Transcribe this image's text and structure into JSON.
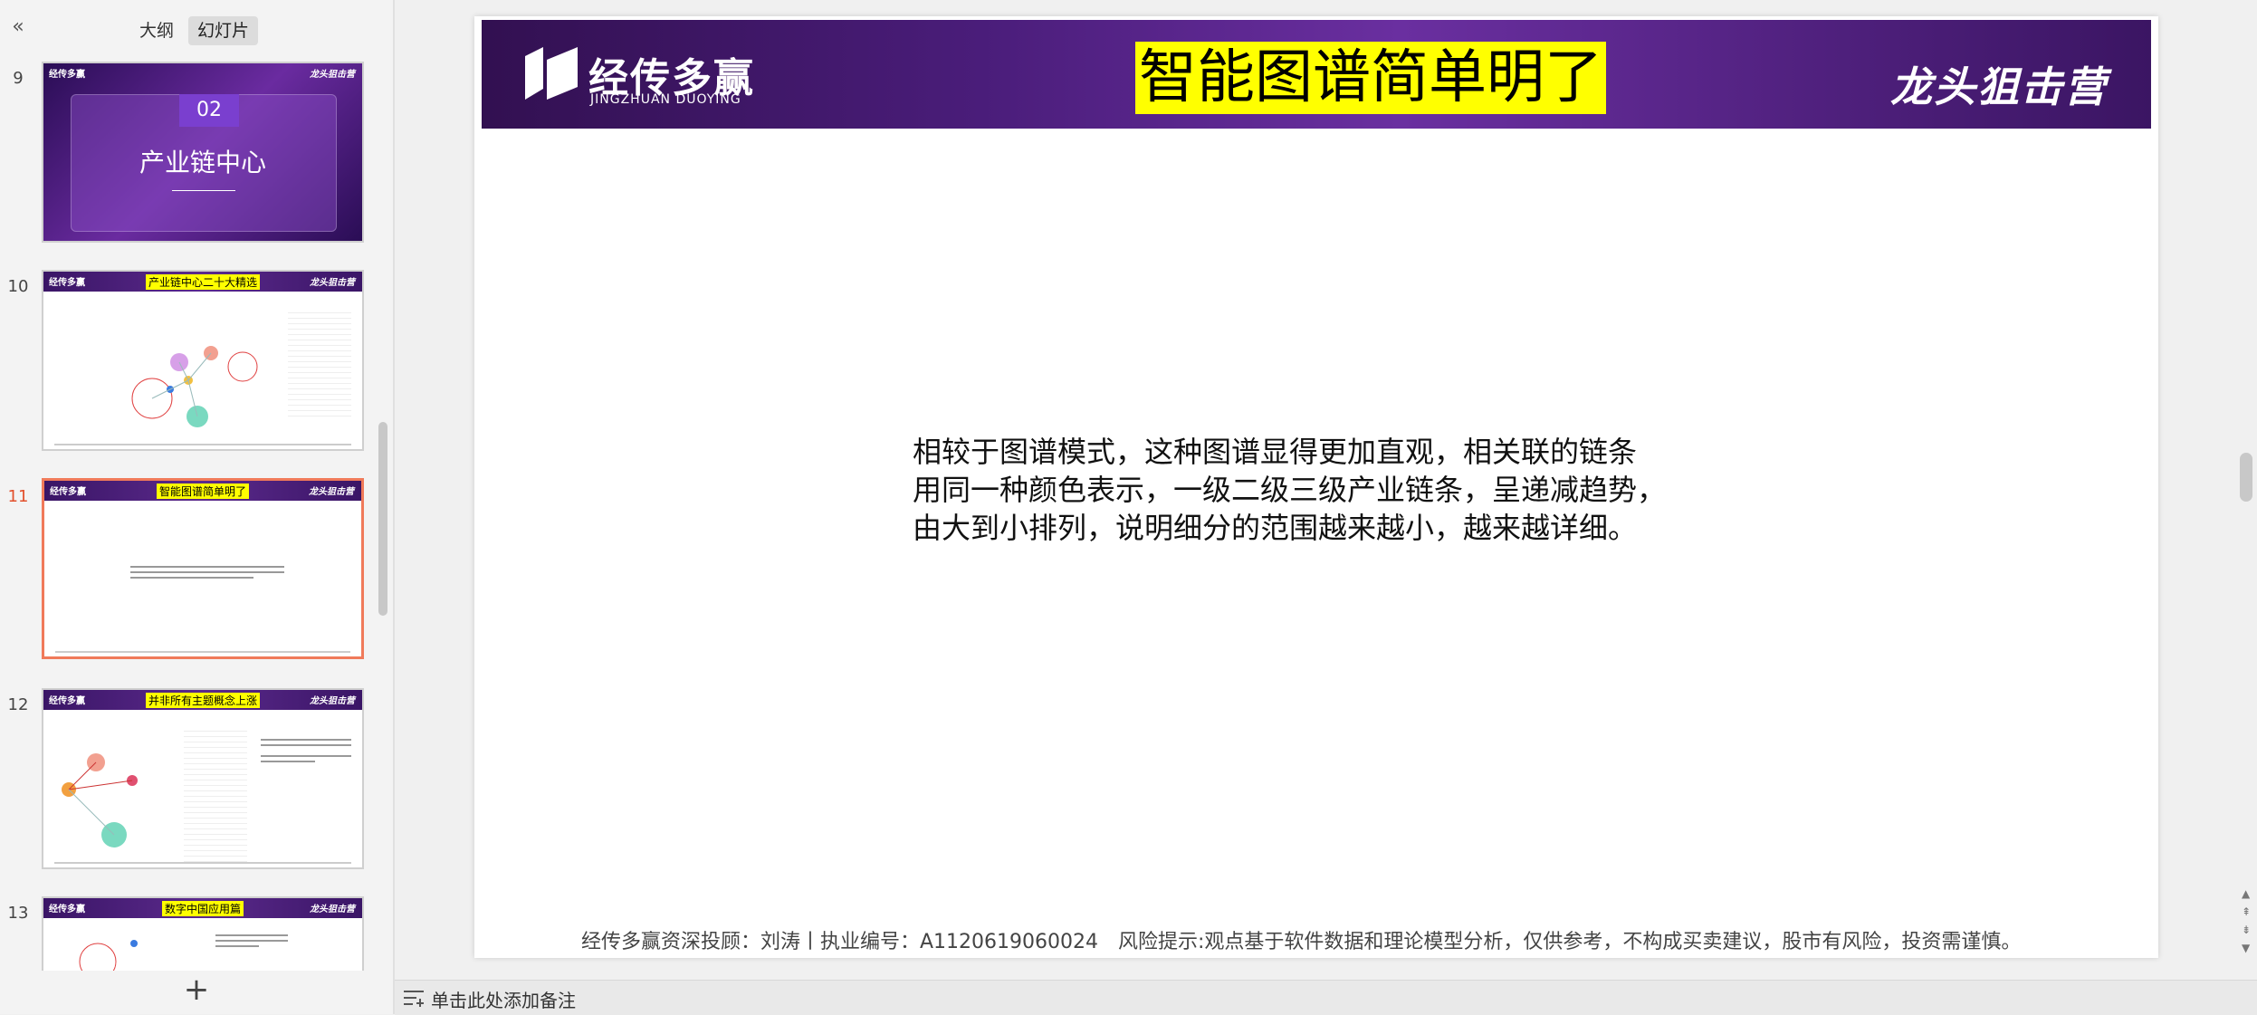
{
  "left_panel": {
    "collapse_icon": "double-chevron-left-icon",
    "tabs": [
      {
        "label": "大纲"
      },
      {
        "label": "幻灯片"
      }
    ],
    "slides": [
      {
        "number": "9",
        "section_number": "02",
        "title": "产业链中心"
      },
      {
        "number": "10",
        "title": "产业链中心二十大精选"
      },
      {
        "number": "11",
        "title": "智能图谱简单明了"
      },
      {
        "number": "12",
        "title": "并非所有主题概念上涨"
      },
      {
        "number": "13",
        "title": "数字中国应用篇"
      }
    ],
    "thumb_logo": "经传多赢",
    "thumb_brand": "龙头狙击营",
    "add_slide_icon": "plus-icon"
  },
  "slide": {
    "logo_cn": "经传多赢",
    "logo_en": "JINGZHUAN DUOYING",
    "title": "智能图谱简单明了",
    "brand": "龙头狙击营",
    "body_lines": [
      "相较于图谱模式，这种图谱显得更加直观，相关联的链条",
      "用同一种颜色表示，一级二级三级产业链条，呈递减趋势，",
      "由大到小排列，说明细分的范围越来越小，越来越详细。"
    ],
    "footer": "经传多赢资深投顾：刘涛丨执业编号：A1120619060024　风险提示:观点基于软件数据和理论模型分析，仅供参考，不构成买卖建议，股市有风险，投资需谨慎。"
  },
  "notes": {
    "placeholder": "单击此处添加备注",
    "icon": "notes-icon"
  },
  "colors": {
    "active": "#f07a5a",
    "title_highlight": "#ffff00",
    "banner": "#4a1d7a"
  }
}
